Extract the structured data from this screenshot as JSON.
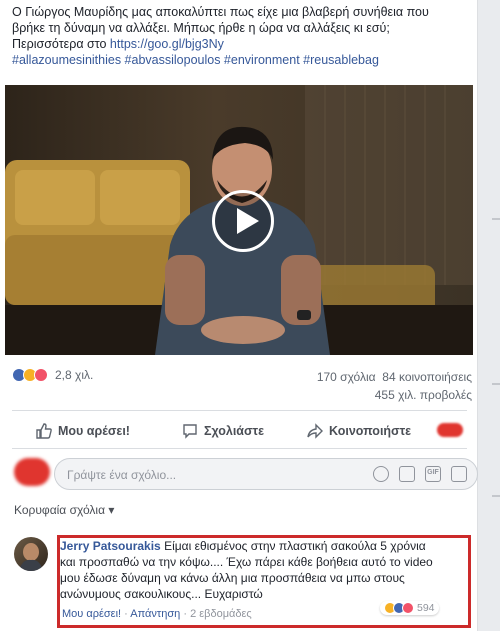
{
  "post": {
    "text_line1": "Ο Γιώργος Μαυρίδης μας αποκαλύπτει πως είχε μια βλαβερή συνήθεια που",
    "text_line2": "βρήκε τη δύναμη να αλλάξει. Μήπως ήρθε η ώρα να αλλάξεις κι εσύ;",
    "text_line3_prefix": "Περισσότερα στο ",
    "link": "https://goo.gl/bjg3Ny",
    "hashtags": "#allazoumesinithies #abvassilopoulos #environment #reusablebag"
  },
  "stats": {
    "reaction_count": "2,8 χιλ.",
    "comments": "170 σχόλια",
    "shares": "84 κοινοποιήσεις",
    "views": "455 χιλ. προβολές"
  },
  "actions": {
    "like": "Μου αρέσει!",
    "comment": "Σχολιάστε",
    "share": "Κοινοποιήστε"
  },
  "comment_input": {
    "placeholder": "Γράψτε ένα σχόλιο...",
    "gif_label": "GIF"
  },
  "sort_label": "Κορυφαία σχόλια ▾",
  "comment": {
    "author": "Jerry Patsourakis",
    "text": " Είμαι εθισμένος στην πλαστική σακούλα 5 χρόνια και προσπαθώ να την κόψω.... Έχω πάρει κάθε βοήθεια αυτό το video μου έδωσε δύναμη να κάνω άλλη μια προσπάθεια να μπω στους ανώνυμους σακουλικους... Ευχαριστώ",
    "like": "Μου αρέσει!",
    "reply": "Απάντηση",
    "time": "2 εβδομάδες",
    "reaction_count": "594"
  },
  "colors": {
    "link": "#365899",
    "highlight": "#cc2a2a",
    "like_blue": "#4267b2",
    "love_red": "#f25268",
    "haha_yellow": "#f7b125"
  }
}
